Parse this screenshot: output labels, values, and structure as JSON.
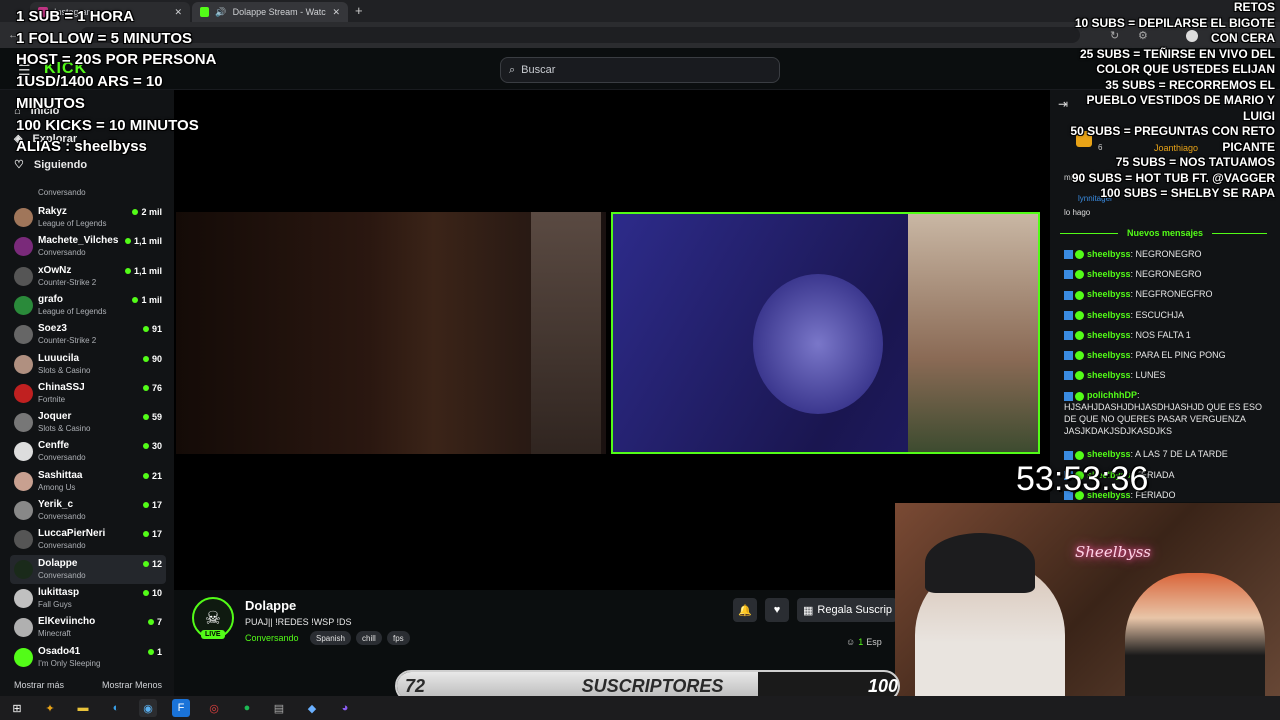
{
  "browser": {
    "tabs": [
      {
        "label": "Instagram"
      },
      {
        "label": "Dolappe Stream - Watch Live"
      }
    ]
  },
  "header": {
    "search_placeholder": "Buscar"
  },
  "sidebar": {
    "nav": [
      {
        "label": "Inicio"
      },
      {
        "label": "Explorar"
      },
      {
        "label": "Siguiendo"
      }
    ],
    "first_cat": "Conversando",
    "channels": [
      {
        "name": "Rakyz",
        "category": "League of Legends",
        "viewers": "2 mil",
        "color": "#a0765a"
      },
      {
        "name": "Machete_Vilches",
        "category": "Conversando",
        "viewers": "1,1 mil",
        "color": "#7a2a7a"
      },
      {
        "name": "xOwNz",
        "category": "Counter-Strike 2",
        "viewers": "1,1 mil",
        "color": "#555"
      },
      {
        "name": "grafo",
        "category": "League of Legends",
        "viewers": "1 mil",
        "color": "#2a8a3a"
      },
      {
        "name": "Soez3",
        "category": "Counter-Strike 2",
        "viewers": "91",
        "color": "#666"
      },
      {
        "name": "Luuucila",
        "category": "Slots & Casino",
        "viewers": "90",
        "color": "#b09080"
      },
      {
        "name": "ChinaSSJ",
        "category": "Fortnite",
        "viewers": "76",
        "color": "#c02020"
      },
      {
        "name": "Joquer",
        "category": "Slots & Casino",
        "viewers": "59",
        "color": "#777"
      },
      {
        "name": "Cenffe",
        "category": "Conversando",
        "viewers": "30",
        "color": "#ddd"
      },
      {
        "name": "Sashittaa",
        "category": "Among Us",
        "viewers": "21",
        "color": "#c8a090"
      },
      {
        "name": "Yerik_c",
        "category": "Conversando",
        "viewers": "17",
        "color": "#888"
      },
      {
        "name": "LuccaPierNeri",
        "category": "Conversando",
        "viewers": "17",
        "color": "#555"
      },
      {
        "name": "Dolappe",
        "category": "Conversando",
        "viewers": "12",
        "color": "#1a2a1a"
      },
      {
        "name": "lukittasp",
        "category": "Fall Guys",
        "viewers": "10",
        "color": "#c0c0c0"
      },
      {
        "name": "ElKeviincho",
        "category": "Minecraft",
        "viewers": "7",
        "color": "#b0b0b0"
      },
      {
        "name": "Osado41",
        "category": "I'm Only Sleeping",
        "viewers": "1",
        "color": "#53fc18"
      }
    ],
    "show_more": "Mostrar más",
    "show_less": "Mostrar Menos"
  },
  "stream": {
    "streamer": "Dolappe",
    "title": "PUAJ|| !REDES !WSP !DS",
    "category": "Conversando",
    "tags": [
      "Spanish",
      "chill",
      "fps"
    ],
    "live": "LIVE",
    "gift_label": "Regala Suscrip",
    "viewers": "1",
    "viewers_suffix": "Esp"
  },
  "chat": {
    "top_user": "Joanthiago",
    "top_count": "6",
    "pinned_user": "lynnitager",
    "pinned_prefix": "min y",
    "pinned_text": "lo hago",
    "new_messages": "Nuevos mensajes",
    "messages": [
      {
        "user": "sheelbyss",
        "text": "NEGRONEGRO"
      },
      {
        "user": "sheelbyss",
        "text": "NEGRONEGRO"
      },
      {
        "user": "sheelbyss",
        "text": "NEGFRONEGFRO"
      },
      {
        "user": "sheelbyss",
        "text": "ESCUCHJA"
      },
      {
        "user": "sheelbyss",
        "text": "NOS FALTA 1"
      },
      {
        "user": "sheelbyss",
        "text": "PARA EL PING PONG"
      },
      {
        "user": "sheelbyss",
        "text": "LUNES"
      },
      {
        "user": "polichhhDP",
        "text": "HJSAHJDASHJDHJASDHJASHJD QUE ES ESO DE QUE NO QUERES PASAR VERGUENZA JASJKDAKJSDJKASDJKS"
      },
      {
        "user": "sheelbyss",
        "text": "A LAS 7 DE LA TARDE"
      },
      {
        "user": "sheelbyss",
        "text": "FERIADA"
      },
      {
        "user": "sheelbyss",
        "text": "FERIADO"
      }
    ]
  },
  "overlay": {
    "left_lines": [
      "1 SUB = 1 HORA",
      "1 FOLLOW = 5 MINUTOS",
      "HOST = 20S POR PERSONA",
      "1USD/1400     ARS     =     10",
      "MINUTOS",
      "100 KICKS = 10 MINUTOS",
      "ALIAS : sheelbyss"
    ],
    "right_lines": [
      "RETOS",
      "10 SUBS = DEPILARSE EL BIGOTE",
      "CON CERA",
      "25 SUBS = TEÑIRSE EN VIVO DEL",
      "COLOR QUE USTEDES ELIJAN",
      "35 SUBS = RECORREMOS EL",
      "PUEBLO VESTIDOS DE MARIO Y",
      "LUIGI",
      "50 SUBS = PREGUNTAS CON RETO",
      "PICANTE",
      "75 SUBS = NOS TATUAMOS",
      "90 SUBS = HOT TUB FT. @VAGGER",
      "100 SUBS = SHELBY SE RAPA"
    ],
    "timer": "53:53:36",
    "neon_sign": "Sheelbyss"
  },
  "subgoal": {
    "current": "72",
    "label": "SUSCRIPTORES",
    "goal": "100",
    "progress": 0.72
  }
}
